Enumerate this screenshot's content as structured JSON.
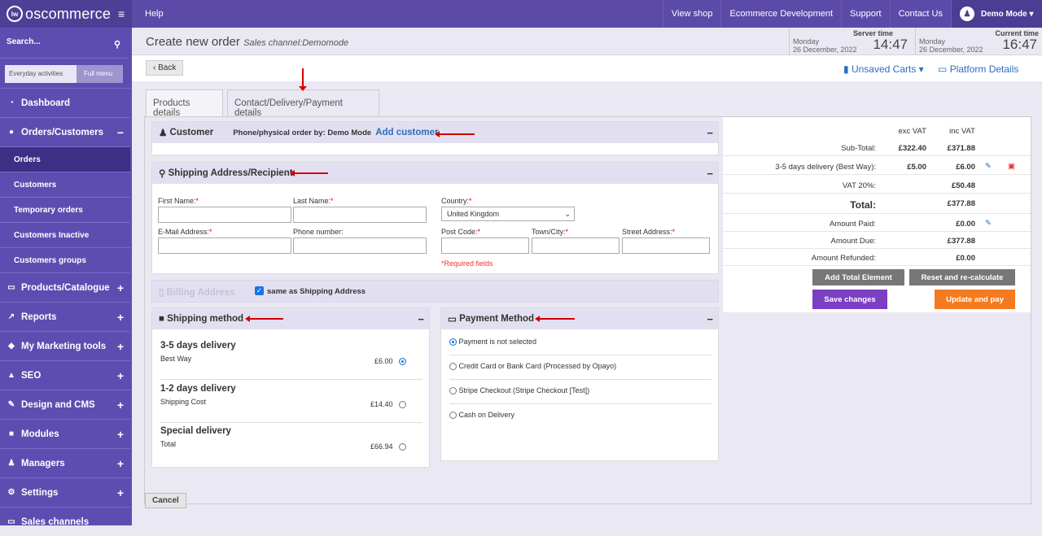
{
  "app": {
    "logo": "oscommerce",
    "logo_badge": "lw"
  },
  "topbar": {
    "help": "Help",
    "links": [
      "View shop",
      "Ecommerce Development",
      "Support",
      "Contact Us"
    ],
    "user": "Demo Mode"
  },
  "sidebar": {
    "search": "Search...",
    "mode_everyday": "Everyday activities",
    "mode_full": "Full menu",
    "items": [
      "Dashboard",
      "Orders/Customers",
      "Orders",
      "Customers",
      "Temporary orders",
      "Customers Inactive",
      "Customers groups",
      "Products/Catalogue",
      "Reports",
      "My Marketing tools",
      "SEO",
      "Design and CMS",
      "Modules",
      "Managers",
      "Settings",
      "Sales channels"
    ]
  },
  "header": {
    "title": "Create new order",
    "channel": "Sales channel:Demomode",
    "server_label": "Server time",
    "server_day": "Monday",
    "server_date": "26 December, 2022",
    "server_time": "14:47",
    "current_label": "Current time",
    "current_day": "Monday",
    "current_date": "26 December, 2022",
    "current_time": "16:47"
  },
  "subbar": {
    "back": "‹ Back",
    "unsaved": "Unsaved Carts ▾",
    "platform": "Platform Details"
  },
  "tabs": [
    "Products details",
    "Contact/Delivery/Payment details"
  ],
  "customer": {
    "title": "Customer",
    "info": "Phone/physical order by: Demo Mode",
    "add": "Add customer"
  },
  "shipping_addr": {
    "title": "Shipping Address/Recipient",
    "first_name": "First Name:",
    "last_name": "Last Name:",
    "country": "Country:",
    "country_value": "United Kingdom",
    "email": "E-Mail Address:",
    "phone": "Phone number:",
    "post": "Post Code:",
    "town": "Town/City:",
    "street": "Street Address:",
    "required": "*Required fields"
  },
  "billing": {
    "title": "Billing Address",
    "same": "same as Shipping Address"
  },
  "shipping_method": {
    "title": "Shipping method",
    "options": [
      {
        "name": "3-5 days delivery",
        "sub": "Best Way",
        "price": "£6.00",
        "selected": true
      },
      {
        "name": "1-2 days delivery",
        "sub": "Shipping Cost",
        "price": "£14.40",
        "selected": false
      },
      {
        "name": "Special delivery",
        "sub": "Total",
        "price": "£66.94",
        "selected": false
      }
    ]
  },
  "payment": {
    "title": "Payment Method",
    "options": [
      "Payment is not selected",
      "Credit Card or Bank Card (Processed by Opayo)",
      "Stripe Checkout (Stripe Checkout [Test])",
      "Cash on Delivery"
    ]
  },
  "totals": {
    "col_ex": "exc VAT",
    "col_inc": "inc VAT",
    "rows": [
      {
        "label": "Sub-Total:",
        "ex": "£322.40",
        "inc": "£371.88"
      },
      {
        "label": "3-5 days delivery (Best Way):",
        "ex": "£5.00",
        "inc": "£6.00"
      },
      {
        "label": "VAT 20%:",
        "ex": "",
        "inc": "£50.48"
      },
      {
        "label": "Total:",
        "ex": "",
        "inc": "£377.88"
      },
      {
        "label": "Amount Paid:",
        "ex": "",
        "inc": "£0.00"
      },
      {
        "label": "Amount Due:",
        "ex": "",
        "inc": "£377.88"
      },
      {
        "label": "Amount Refunded:",
        "ex": "",
        "inc": "£0.00"
      }
    ],
    "add_total": "Add Total Element",
    "reset": "Reset and re-calculate",
    "save": "Save changes",
    "update": "Update and pay"
  },
  "cancel": "Cancel",
  "colors": {
    "sidebar": "#5e4db1",
    "topbar": "#5b4aa8",
    "accent": "#7b3fc4",
    "orange": "#f47b20",
    "link": "#2a6ebd",
    "arrow": "#d40000"
  }
}
